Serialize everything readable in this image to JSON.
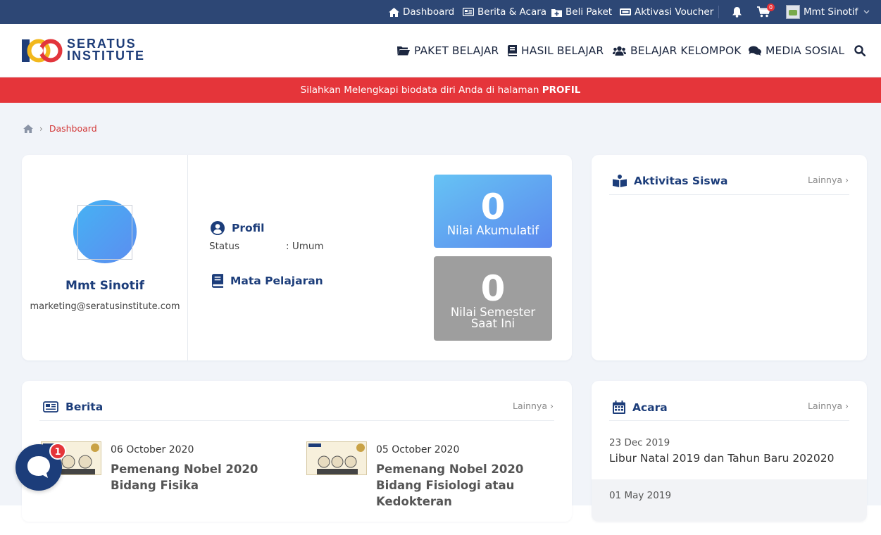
{
  "topbar": {
    "dashboard": "Dashboard",
    "news_events": "Berita & Acara",
    "buy_package": "Beli Paket",
    "activate_voucher": "Aktivasi Voucher",
    "cart_count": "0",
    "user_name": "Mmt Sinotif"
  },
  "header": {
    "logo_line1": "SERATUS",
    "logo_line2": "INSTITUTE",
    "nav": [
      "PAKET BELAJAR",
      "HASIL BELAJAR",
      "BELAJAR KELOMPOK",
      "MEDIA SOSIAL"
    ]
  },
  "alert": {
    "text": "Silahkan Melengkapi biodata diri Anda di halaman",
    "link": "PROFIL"
  },
  "breadcrumb": {
    "current": "Dashboard"
  },
  "profile": {
    "name": "Mmt Sinotif",
    "email": "marketing@seratusinstitute.com",
    "section_profile": "Profil",
    "status_label": "Status",
    "status_value": ": Umum",
    "section_subjects": "Mata Pelajaran",
    "score1_value": "0",
    "score1_label": "Nilai Akumulatif",
    "score2_value": "0",
    "score2_label_line1": "Nilai Semester",
    "score2_label_line2": "Saat Ini"
  },
  "aktivitas": {
    "title": "Aktivitas Siswa",
    "more": "Lainnya ›"
  },
  "berita": {
    "title": "Berita",
    "more": "Lainnya ›",
    "items": [
      {
        "date": "06 October 2020",
        "title": "Pemenang Nobel 2020 Bidang Fisika"
      },
      {
        "date": "05 October 2020",
        "title": "Pemenang Nobel 2020 Bidang Fisiologi atau Kedokteran"
      }
    ]
  },
  "acara": {
    "title": "Acara",
    "more": "Lainnya ›",
    "items": [
      {
        "date": "23 Dec 2019",
        "title": "Libur Natal 2019 dan Tahun Baru 202020"
      },
      {
        "date": "01 May 2019",
        "title": ""
      }
    ]
  },
  "chat": {
    "badge": "1"
  },
  "colors": {
    "navy": "#2d4775",
    "brand_blue": "#1c3d7a",
    "alert_red": "#e5353a",
    "page_bg": "#f1f4f9"
  }
}
